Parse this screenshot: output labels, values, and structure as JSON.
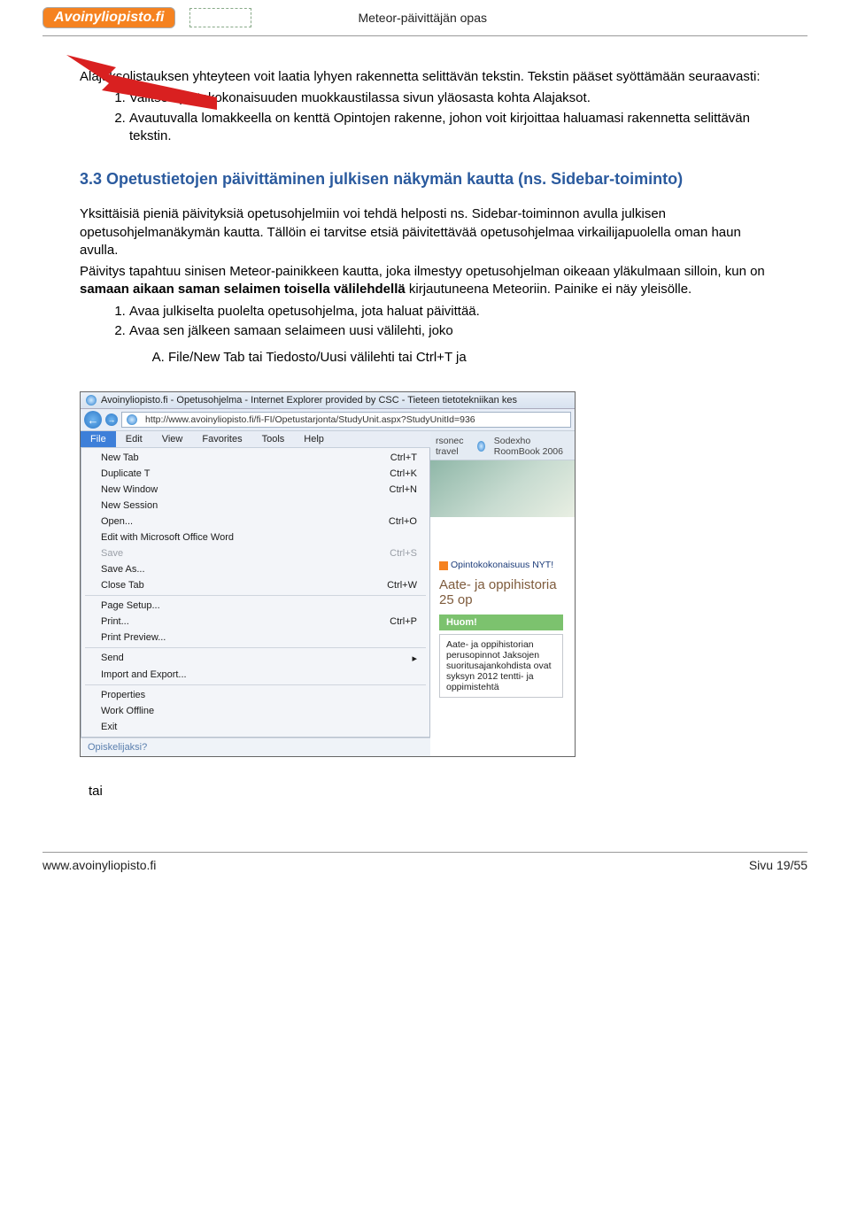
{
  "header": {
    "logo": "Avoinyliopisto.fi",
    "title": "Meteor-päivittäjän opas"
  },
  "body": {
    "intro1": "Alajaksolistauksen yhteyteen voit laatia lyhyen rakennetta selittävän tekstin. Tekstin pääset syöttämään seuraavasti:",
    "list1": {
      "i1": "Valitse opintokokonaisuuden muokkaustilassa sivun yläosasta kohta Alajaksot.",
      "i2": "Avautuvalla lomakkeella on kenttä Opintojen rakenne, johon voit kirjoittaa haluamasi rakennetta selittävän tekstin."
    },
    "heading": "3.3 Opetustietojen päivittäminen julkisen näkymän kautta (ns. Sidebar-toiminto)",
    "para1": "Yksittäisiä pieniä päivityksiä opetusohjelmiin voi tehdä helposti ns. Sidebar-toiminnon avulla julkisen opetusohjelmanäkymän kautta. Tällöin ei tarvitse etsiä päivitettävää opetusohjelmaa virkailijapuolella oman haun avulla.",
    "para2a": "Päivitys tapahtuu sinisen Meteor-painikkeen kautta, joka ilmestyy opetusohjelman oikeaan yläkulmaan silloin, kun on ",
    "para2b": "samaan aikaan saman selaimen toisella välilehdellä",
    "para2c": " kirjautuneena Meteoriin. Painike ei näy yleisölle.",
    "list2": {
      "i1": "Avaa julkiselta puolelta opetusohjelma, jota haluat päivittää.",
      "i2": "Avaa sen jälkeen samaan selaimeen uusi välilehti, joko"
    },
    "list3": {
      "iA": "File/New Tab tai Tiedosto/Uusi välilehti tai Ctrl+T ja"
    },
    "tai": "tai"
  },
  "screenshot": {
    "title": "Avoinyliopisto.fi - Opetusohjelma - Internet Explorer provided by CSC - Tieteen tietotekniikan kes",
    "url": "http://www.avoinyliopisto.fi/fi-FI/Opetustarjonta/StudyUnit.aspx?StudyUnitId=936",
    "menubar": [
      "File",
      "Edit",
      "View",
      "Favorites",
      "Tools",
      "Help"
    ],
    "dropdown": [
      {
        "label": "New Tab",
        "sc": "Ctrl+T",
        "disabled": false
      },
      {
        "label": "Duplicate T",
        "sc": "Ctrl+K",
        "disabled": false
      },
      {
        "label": "New Window",
        "sc": "Ctrl+N",
        "disabled": false
      },
      {
        "label": "New Session",
        "sc": "",
        "disabled": false
      },
      {
        "label": "Open...",
        "sc": "Ctrl+O",
        "disabled": false
      },
      {
        "label": "Edit with Microsoft Office Word",
        "sc": "",
        "disabled": false
      },
      {
        "label": "Save",
        "sc": "Ctrl+S",
        "disabled": true
      },
      {
        "label": "Save As...",
        "sc": "",
        "disabled": false
      },
      {
        "label": "Close Tab",
        "sc": "Ctrl+W",
        "disabled": false
      },
      {
        "sep": true
      },
      {
        "label": "Page Setup...",
        "sc": "",
        "disabled": false
      },
      {
        "label": "Print...",
        "sc": "Ctrl+P",
        "disabled": false
      },
      {
        "label": "Print Preview...",
        "sc": "",
        "disabled": false
      },
      {
        "sep": true
      },
      {
        "label": "Send",
        "sc": "▸",
        "disabled": false
      },
      {
        "label": "Import and Export...",
        "sc": "",
        "disabled": false
      },
      {
        "sep": true
      },
      {
        "label": "Properties",
        "sc": "",
        "disabled": false
      },
      {
        "label": "Work Offline",
        "sc": "",
        "disabled": false
      },
      {
        "label": "Exit",
        "sc": "",
        "disabled": false
      }
    ],
    "tabs": {
      "t1": "rsonec travel",
      "t2": "Sodexho RoomBook 2006"
    },
    "panel": {
      "link": "Opintokokonaisuus NYT!",
      "heading": "Aate- ja oppihistoria 25 op",
      "huom": "Huom!",
      "huomtext": "Aate- ja oppihistorian perusopinnot Jaksojen suoritusajankohdista ovat syksyn 2012 tentti- ja oppimistehtä"
    },
    "opisk": "Opiskelijaksi?"
  },
  "footer": {
    "left": "www.avoinyliopisto.fi",
    "right": "Sivu 19/55"
  }
}
